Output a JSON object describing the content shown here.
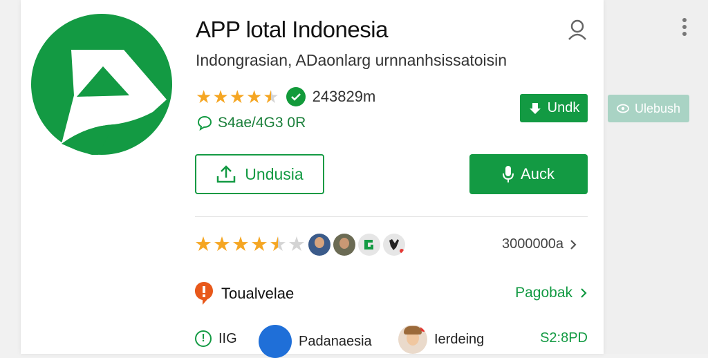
{
  "app": {
    "title": "APP lotal Indonesia",
    "subtitle": "Indongrasian, ADaonlarg urnnanhsissatoisin"
  },
  "rating": {
    "top_count": "243829m",
    "top_stars": 4.5,
    "comment_text": "S4ae/4G3 0R",
    "bottom_stars": 4.5,
    "reviews_count": "3000000a"
  },
  "buttons": {
    "install": "Undk",
    "update": "Undusia",
    "primary": "Auck",
    "side": "Ulebush"
  },
  "section": {
    "title": "Toualvelae",
    "link": "Pagobak"
  },
  "bottom": {
    "item1": "IIG",
    "item2": "Padanaesia",
    "item3": "Ierdeing",
    "price": "S2:8PD"
  },
  "colors": {
    "brand_green": "#139a43",
    "star": "#f5a623",
    "section_icon": "#e8581a"
  },
  "icons": [
    "person-icon",
    "more-vert-icon",
    "check-circle-icon",
    "chat-bubble-icon",
    "download-icon",
    "upload-icon",
    "microphone-icon",
    "eye-icon",
    "chevron-right-icon",
    "info-icon"
  ]
}
